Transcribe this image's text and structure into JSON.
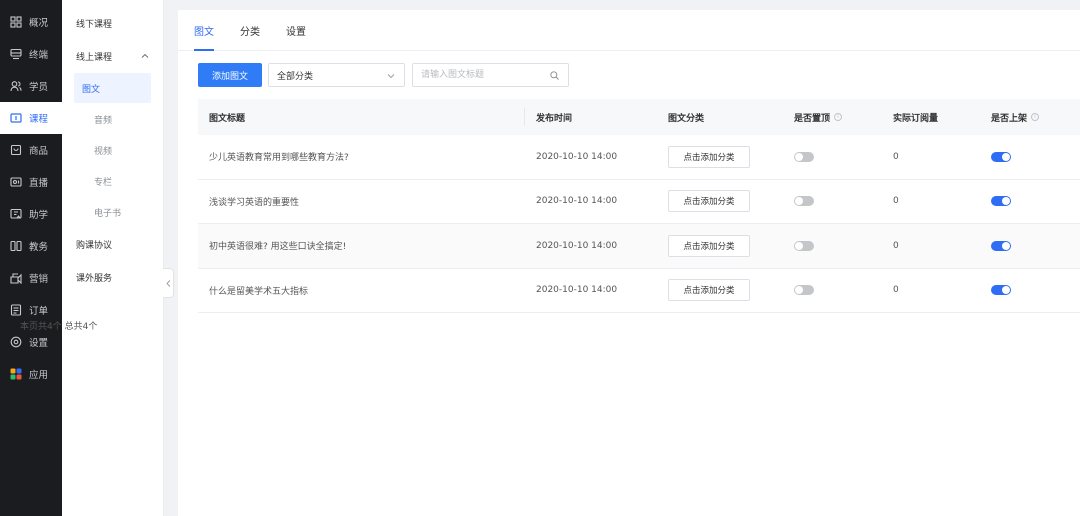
{
  "nav": {
    "items": [
      {
        "label": "概况",
        "icon": "grid-icon"
      },
      {
        "label": "终端",
        "icon": "terminal-icon"
      },
      {
        "label": "学员",
        "icon": "users-icon"
      },
      {
        "label": "课程",
        "icon": "course-icon"
      },
      {
        "label": "商品",
        "icon": "goods-icon"
      },
      {
        "label": "直播",
        "icon": "live-icon"
      },
      {
        "label": "助学",
        "icon": "study-icon"
      },
      {
        "label": "教务",
        "icon": "academic-icon"
      },
      {
        "label": "营销",
        "icon": "marketing-icon"
      },
      {
        "label": "订单",
        "icon": "order-icon"
      },
      {
        "label": "设置",
        "icon": "settings-icon"
      },
      {
        "label": "应用",
        "icon": "apps-icon"
      }
    ],
    "active_index": 3,
    "active_color": "#2f6df5"
  },
  "sub": {
    "offline": "线下课程",
    "online": "线上课程",
    "children": [
      "图文",
      "音频",
      "视频",
      "专栏",
      "电子书"
    ],
    "purchase": "购课协议",
    "extra": "课外服务"
  },
  "tabs": [
    "图文",
    "分类",
    "设置"
  ],
  "toolbar": {
    "add_label": "添加图文",
    "select_value": "全部分类",
    "search_placeholder": "请输入图文标题"
  },
  "table": {
    "headers": [
      "图文标题",
      "发布时间",
      "图文分类",
      "是否置顶",
      "实际订阅量",
      "是否上架"
    ],
    "rows": [
      {
        "title": "少儿英语教育常用到哪些教育方法?",
        "date": "2020-10-10 14:00",
        "category": "点击添加分类",
        "pinned": false,
        "subs": "0",
        "listed": true
      },
      {
        "title": "浅谈学习英语的重要性",
        "date": "2020-10-10 14:00",
        "category": "点击添加分类",
        "pinned": false,
        "subs": "0",
        "listed": true
      },
      {
        "title": "初中英语很难? 用这些口诀全搞定!",
        "date": "2020-10-10 14:00",
        "category": "点击添加分类",
        "pinned": false,
        "subs": "0",
        "listed": true
      },
      {
        "title": "什么是留美学术五大指标",
        "date": "2020-10-10 14:00",
        "category": "点击添加分类",
        "pinned": false,
        "subs": "0",
        "listed": true
      }
    ]
  },
  "footer": "本页共4个 总共4个"
}
